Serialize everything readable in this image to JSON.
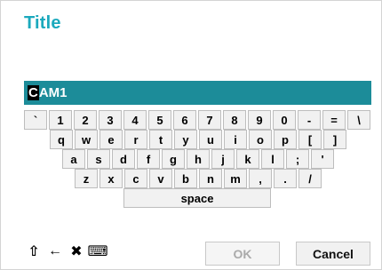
{
  "dialog": {
    "title": "Title"
  },
  "input": {
    "caret_char": "C",
    "rest_text": "AM1"
  },
  "keyboard": {
    "rows": [
      [
        "`",
        "1",
        "2",
        "3",
        "4",
        "5",
        "6",
        "7",
        "8",
        "9",
        "0",
        "-",
        "=",
        "\\"
      ],
      [
        "q",
        "w",
        "e",
        "r",
        "t",
        "y",
        "u",
        "i",
        "o",
        "p",
        "[",
        "]"
      ],
      [
        "a",
        "s",
        "d",
        "f",
        "g",
        "h",
        "j",
        "k",
        "l",
        ";",
        "'"
      ],
      [
        "z",
        "x",
        "c",
        "v",
        "b",
        "n",
        "m",
        ",",
        ".",
        "/"
      ]
    ],
    "space_label": "space"
  },
  "toolbar": {
    "shift_icon": "⇧",
    "backspace_icon": "←",
    "clear_icon": "✖",
    "keyboard_icon": "⌨"
  },
  "buttons": {
    "ok_label": "OK",
    "cancel_label": "Cancel"
  },
  "colors": {
    "title": "#1ba9bd",
    "input_bg": "#1c8c99"
  }
}
